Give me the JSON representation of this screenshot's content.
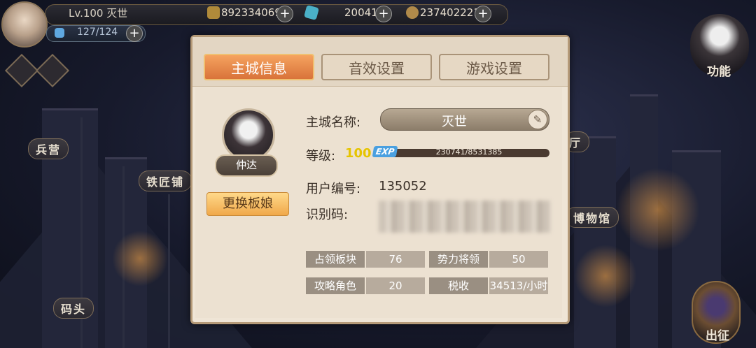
{
  "hud": {
    "level_name": "Lv.100  灭世",
    "energy": "127/124",
    "currency1": "892334069",
    "currency2": "20041",
    "currency3": "237402221"
  },
  "map_labels": {
    "barracks": "兵营",
    "smithy": "铁匠铺",
    "hall": "厅",
    "museum": "博物馆",
    "dock": "码头"
  },
  "side": {
    "function_label": "功能",
    "expedition_label": "出征"
  },
  "tabs": [
    "主城信息",
    "音效设置",
    "游戏设置"
  ],
  "info": {
    "character_name": "仲达",
    "change_button": "更换板娘",
    "city_name_label": "主城名称:",
    "city_name": "灭世",
    "level_label": "等级:",
    "level": "100",
    "exp_tag": "EXP",
    "exp_text": "230741/8531385",
    "exp_fraction": 0.027,
    "user_id_label": "用户编号:",
    "user_id": "135052",
    "code_label": "识别码:"
  },
  "stats": [
    {
      "label": "占领板块",
      "value": "76"
    },
    {
      "label": "势力将领",
      "value": "50"
    },
    {
      "label": "攻略角色",
      "value": "20"
    },
    {
      "label": "税收",
      "value": "34513/小时"
    }
  ],
  "colors": {
    "tab_active": "#e8894a",
    "panel_bg": "#ece1d1",
    "level_yellow": "#e6c400",
    "change_button": "#f5bd66"
  }
}
